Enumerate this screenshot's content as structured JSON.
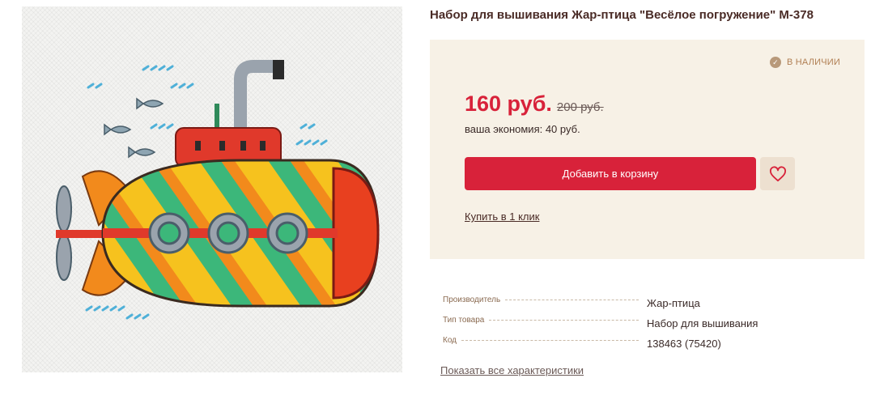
{
  "product": {
    "title": "Набор для вышивания Жар-птица \"Весёлое погружение\" М-378",
    "image_alt": "Вышивка: жёлтая подводная лодка с иллюминаторами и рыбками"
  },
  "buy_box": {
    "stock_status": "В НАЛИЧИИ",
    "price": "160 руб.",
    "old_price": "200 руб.",
    "savings": "ваша экономия: 40 руб.",
    "add_to_cart_label": "Добавить в корзину",
    "one_click_label": "Купить в 1 клик",
    "wishlist_icon": "heart-icon",
    "stock_icon": "check-circle-icon"
  },
  "specs": [
    {
      "label": "Производитель",
      "value": "Жар-птица"
    },
    {
      "label": "Тип товара",
      "value": "Набор для вышивания"
    },
    {
      "label": "Код",
      "value": "138463 (75420)"
    }
  ],
  "all_specs_label": "Показать все характеристики",
  "colors": {
    "accent": "#d8223a",
    "box_bg": "#f7f1e6",
    "title": "#4a2b26"
  }
}
